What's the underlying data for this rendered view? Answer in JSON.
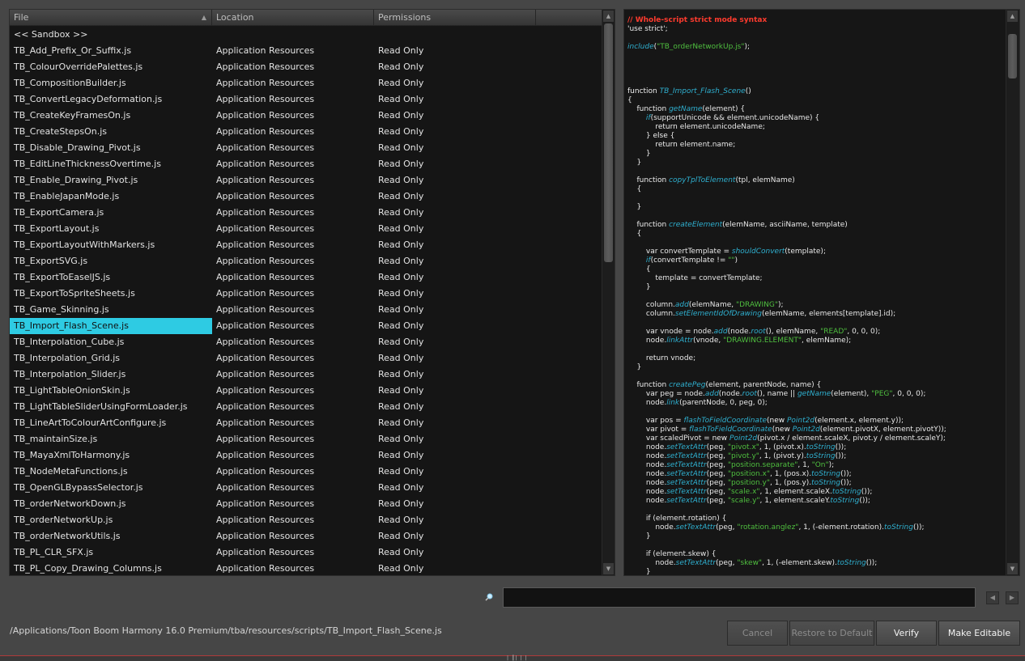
{
  "file_table": {
    "columns": {
      "file": "File",
      "location": "Location",
      "permissions": "Permissions"
    },
    "selected_index": 19,
    "rows": [
      {
        "file": "<< Sandbox >>",
        "location": "",
        "permissions": ""
      },
      {
        "file": "TB_Add_Prefix_Or_Suffix.js",
        "location": "Application Resources",
        "permissions": "Read Only"
      },
      {
        "file": "TB_ColourOverridePalettes.js",
        "location": "Application Resources",
        "permissions": "Read Only"
      },
      {
        "file": "TB_CompositionBuilder.js",
        "location": "Application Resources",
        "permissions": "Read Only"
      },
      {
        "file": "TB_ConvertLegacyDeformation.js",
        "location": "Application Resources",
        "permissions": "Read Only"
      },
      {
        "file": "TB_CreateKeyFramesOn.js",
        "location": "Application Resources",
        "permissions": "Read Only"
      },
      {
        "file": "TB_CreateStepsOn.js",
        "location": "Application Resources",
        "permissions": "Read Only"
      },
      {
        "file": "TB_Disable_Drawing_Pivot.js",
        "location": "Application Resources",
        "permissions": "Read Only"
      },
      {
        "file": "TB_EditLineThicknessOvertime.js",
        "location": "Application Resources",
        "permissions": "Read Only"
      },
      {
        "file": "TB_Enable_Drawing_Pivot.js",
        "location": "Application Resources",
        "permissions": "Read Only"
      },
      {
        "file": "TB_EnableJapanMode.js",
        "location": "Application Resources",
        "permissions": "Read Only"
      },
      {
        "file": "TB_ExportCamera.js",
        "location": "Application Resources",
        "permissions": "Read Only"
      },
      {
        "file": "TB_ExportLayout.js",
        "location": "Application Resources",
        "permissions": "Read Only"
      },
      {
        "file": "TB_ExportLayoutWithMarkers.js",
        "location": "Application Resources",
        "permissions": "Read Only"
      },
      {
        "file": "TB_ExportSVG.js",
        "location": "Application Resources",
        "permissions": "Read Only"
      },
      {
        "file": "TB_ExportToEaselJS.js",
        "location": "Application Resources",
        "permissions": "Read Only"
      },
      {
        "file": "TB_ExportToSpriteSheets.js",
        "location": "Application Resources",
        "permissions": "Read Only"
      },
      {
        "file": "TB_Game_Skinning.js",
        "location": "Application Resources",
        "permissions": "Read Only"
      },
      {
        "file": "TB_Import_Flash_Scene.js",
        "location": "Application Resources",
        "permissions": "Read Only"
      },
      {
        "file": "TB_Interpolation_Cube.js",
        "location": "Application Resources",
        "permissions": "Read Only"
      },
      {
        "file": "TB_Interpolation_Grid.js",
        "location": "Application Resources",
        "permissions": "Read Only"
      },
      {
        "file": "TB_Interpolation_Slider.js",
        "location": "Application Resources",
        "permissions": "Read Only"
      },
      {
        "file": "TB_LightTableOnionSkin.js",
        "location": "Application Resources",
        "permissions": "Read Only"
      },
      {
        "file": "TB_LightTableSliderUsingFormLoader.js",
        "location": "Application Resources",
        "permissions": "Read Only"
      },
      {
        "file": "TB_LineArtToColourArtConfigure.js",
        "location": "Application Resources",
        "permissions": "Read Only"
      },
      {
        "file": "TB_maintainSize.js",
        "location": "Application Resources",
        "permissions": "Read Only"
      },
      {
        "file": "TB_MayaXmlToHarmony.js",
        "location": "Application Resources",
        "permissions": "Read Only"
      },
      {
        "file": "TB_NodeMetaFunctions.js",
        "location": "Application Resources",
        "permissions": "Read Only"
      },
      {
        "file": "TB_OpenGLBypassSelector.js",
        "location": "Application Resources",
        "permissions": "Read Only"
      },
      {
        "file": "TB_orderNetworkDown.js",
        "location": "Application Resources",
        "permissions": "Read Only"
      },
      {
        "file": "TB_orderNetworkUp.js",
        "location": "Application Resources",
        "permissions": "Read Only"
      },
      {
        "file": "TB_orderNetworkUtils.js",
        "location": "Application Resources",
        "permissions": "Read Only"
      },
      {
        "file": "TB_PL_CLR_SFX.js",
        "location": "Application Resources",
        "permissions": "Read Only"
      },
      {
        "file": "TB_PL_Copy_Drawing_Columns.js",
        "location": "Application Resources",
        "permissions": "Read Only"
      }
    ]
  },
  "code_editor": {
    "lines": [
      [
        [
          "c",
          "// Whole-script strict mode syntax"
        ]
      ],
      [
        [
          "p",
          "'use strict';"
        ]
      ],
      [],
      [
        [
          "f",
          "include"
        ],
        [
          "p",
          "("
        ],
        [
          "s",
          "\"TB_orderNetworkUp.js\""
        ],
        [
          "p",
          ");"
        ]
      ],
      [],
      [],
      [],
      [],
      [
        [
          "k",
          "function "
        ],
        [
          "f",
          "TB_Import_Flash_Scene"
        ],
        [
          "p",
          "()"
        ]
      ],
      [
        [
          "p",
          "{"
        ]
      ],
      [
        [
          "k",
          "    function "
        ],
        [
          "f",
          "getName"
        ],
        [
          "p",
          "(element) {"
        ]
      ],
      [
        [
          "p",
          "        "
        ],
        [
          "f",
          "if"
        ],
        [
          "p",
          "(supportUnicode && element.unicodeName) {"
        ]
      ],
      [
        [
          "k",
          "            return "
        ],
        [
          "p",
          "element.unicodeName;"
        ]
      ],
      [
        [
          "p",
          "        } "
        ],
        [
          "k",
          "else"
        ],
        [
          "p",
          " {"
        ]
      ],
      [
        [
          "k",
          "            return "
        ],
        [
          "p",
          "element.name;"
        ]
      ],
      [
        [
          "p",
          "        }"
        ]
      ],
      [
        [
          "p",
          "    }"
        ]
      ],
      [],
      [
        [
          "k",
          "    function "
        ],
        [
          "f",
          "copyTplToElement"
        ],
        [
          "p",
          "(tpl, elemName)"
        ]
      ],
      [
        [
          "p",
          "    {"
        ]
      ],
      [],
      [
        [
          "p",
          "    }"
        ]
      ],
      [],
      [
        [
          "k",
          "    function "
        ],
        [
          "f",
          "createElement"
        ],
        [
          "p",
          "(elemName, asciiName, template)"
        ]
      ],
      [
        [
          "p",
          "    {"
        ]
      ],
      [],
      [
        [
          "k",
          "        var "
        ],
        [
          "p",
          "convertTemplate = "
        ],
        [
          "f",
          "shouldConvert"
        ],
        [
          "p",
          "(template);"
        ]
      ],
      [
        [
          "p",
          "        "
        ],
        [
          "f",
          "if"
        ],
        [
          "p",
          "(convertTemplate != "
        ],
        [
          "s",
          "\"\""
        ],
        [
          "p",
          ")"
        ]
      ],
      [
        [
          "p",
          "        {"
        ]
      ],
      [
        [
          "p",
          "            template = convertTemplate;"
        ]
      ],
      [
        [
          "p",
          "        }"
        ]
      ],
      [],
      [
        [
          "p",
          "        column."
        ],
        [
          "f",
          "add"
        ],
        [
          "p",
          "(elemName, "
        ],
        [
          "s",
          "\"DRAWING\""
        ],
        [
          "p",
          ");"
        ]
      ],
      [
        [
          "p",
          "        column."
        ],
        [
          "f",
          "setElementIdOfDrawing"
        ],
        [
          "p",
          "(elemName, elements[template].id);"
        ]
      ],
      [],
      [
        [
          "k",
          "        var "
        ],
        [
          "p",
          "vnode = node."
        ],
        [
          "f",
          "add"
        ],
        [
          "p",
          "(node."
        ],
        [
          "f",
          "root"
        ],
        [
          "p",
          "(), elemName, "
        ],
        [
          "s",
          "\"READ\""
        ],
        [
          "p",
          ", 0, 0, 0);"
        ]
      ],
      [
        [
          "p",
          "        node."
        ],
        [
          "f",
          "linkAttr"
        ],
        [
          "p",
          "(vnode, "
        ],
        [
          "s",
          "\"DRAWING.ELEMENT\""
        ],
        [
          "p",
          ", elemName);"
        ]
      ],
      [],
      [
        [
          "k",
          "        return "
        ],
        [
          "p",
          "vnode;"
        ]
      ],
      [
        [
          "p",
          "    }"
        ]
      ],
      [],
      [
        [
          "k",
          "    function "
        ],
        [
          "f",
          "createPeg"
        ],
        [
          "p",
          "(element, parentNode, name) {"
        ]
      ],
      [
        [
          "k",
          "        var "
        ],
        [
          "p",
          "peg = node."
        ],
        [
          "f",
          "add"
        ],
        [
          "p",
          "(node."
        ],
        [
          "f",
          "root"
        ],
        [
          "p",
          "(), name || "
        ],
        [
          "f",
          "getName"
        ],
        [
          "p",
          "(element), "
        ],
        [
          "s",
          "\"PEG\""
        ],
        [
          "p",
          ", 0, 0, 0);"
        ]
      ],
      [
        [
          "p",
          "        node."
        ],
        [
          "f",
          "link"
        ],
        [
          "p",
          "(parentNode, 0, peg, 0);"
        ]
      ],
      [],
      [
        [
          "k",
          "        var "
        ],
        [
          "p",
          "pos = "
        ],
        [
          "f",
          "flashToFieldCoordinate"
        ],
        [
          "p",
          "("
        ],
        [
          "k",
          "new "
        ],
        [
          "f",
          "Point2d"
        ],
        [
          "p",
          "(element.x, element.y));"
        ]
      ],
      [
        [
          "k",
          "        var "
        ],
        [
          "p",
          "pivot = "
        ],
        [
          "f",
          "flashToFieldCoordinate"
        ],
        [
          "p",
          "("
        ],
        [
          "k",
          "new "
        ],
        [
          "f",
          "Point2d"
        ],
        [
          "p",
          "(element.pivotX, element.pivotY));"
        ]
      ],
      [
        [
          "k",
          "        var "
        ],
        [
          "p",
          "scaledPivot = "
        ],
        [
          "k",
          "new "
        ],
        [
          "f",
          "Point2d"
        ],
        [
          "p",
          "(pivot.x / element.scaleX, pivot.y / element.scaleY);"
        ]
      ],
      [
        [
          "p",
          "        node."
        ],
        [
          "f",
          "setTextAttr"
        ],
        [
          "p",
          "(peg, "
        ],
        [
          "s",
          "\"pivot.x\""
        ],
        [
          "p",
          ", 1, (pivot.x)."
        ],
        [
          "f",
          "toString"
        ],
        [
          "p",
          "());"
        ]
      ],
      [
        [
          "p",
          "        node."
        ],
        [
          "f",
          "setTextAttr"
        ],
        [
          "p",
          "(peg, "
        ],
        [
          "s",
          "\"pivot.y\""
        ],
        [
          "p",
          ", 1, (pivot.y)."
        ],
        [
          "f",
          "toString"
        ],
        [
          "p",
          "());"
        ]
      ],
      [
        [
          "p",
          "        node."
        ],
        [
          "f",
          "setTextAttr"
        ],
        [
          "p",
          "(peg, "
        ],
        [
          "s",
          "\"position.separate\""
        ],
        [
          "p",
          ", 1, "
        ],
        [
          "s",
          "\"On\""
        ],
        [
          "p",
          ");"
        ]
      ],
      [
        [
          "p",
          "        node."
        ],
        [
          "f",
          "setTextAttr"
        ],
        [
          "p",
          "(peg, "
        ],
        [
          "s",
          "\"position.x\""
        ],
        [
          "p",
          ", 1, (pos.x)."
        ],
        [
          "f",
          "toString"
        ],
        [
          "p",
          "());"
        ]
      ],
      [
        [
          "p",
          "        node."
        ],
        [
          "f",
          "setTextAttr"
        ],
        [
          "p",
          "(peg, "
        ],
        [
          "s",
          "\"position.y\""
        ],
        [
          "p",
          ", 1, (pos.y)."
        ],
        [
          "f",
          "toString"
        ],
        [
          "p",
          "());"
        ]
      ],
      [
        [
          "p",
          "        node."
        ],
        [
          "f",
          "setTextAttr"
        ],
        [
          "p",
          "(peg, "
        ],
        [
          "s",
          "\"scale.x\""
        ],
        [
          "p",
          ", 1, element.scaleX."
        ],
        [
          "f",
          "toString"
        ],
        [
          "p",
          "());"
        ]
      ],
      [
        [
          "p",
          "        node."
        ],
        [
          "f",
          "setTextAttr"
        ],
        [
          "p",
          "(peg, "
        ],
        [
          "s",
          "\"scale.y\""
        ],
        [
          "p",
          ", 1, element.scaleY."
        ],
        [
          "f",
          "toString"
        ],
        [
          "p",
          "());"
        ]
      ],
      [],
      [
        [
          "p",
          "        if (element.rotation) {"
        ]
      ],
      [
        [
          "p",
          "            node."
        ],
        [
          "f",
          "setTextAttr"
        ],
        [
          "p",
          "(peg, "
        ],
        [
          "s",
          "\"rotation.anglez\""
        ],
        [
          "p",
          ", 1, (-element.rotation)."
        ],
        [
          "f",
          "toString"
        ],
        [
          "p",
          "());"
        ]
      ],
      [
        [
          "p",
          "        }"
        ]
      ],
      [],
      [
        [
          "p",
          "        if (element.skew) {"
        ]
      ],
      [
        [
          "p",
          "            node."
        ],
        [
          "f",
          "setTextAttr"
        ],
        [
          "p",
          "(peg, "
        ],
        [
          "s",
          "\"skew\""
        ],
        [
          "p",
          ", 1, (-element.skew)."
        ],
        [
          "f",
          "toString"
        ],
        [
          "p",
          "());"
        ]
      ],
      [
        [
          "p",
          "        }"
        ]
      ]
    ]
  },
  "search": {
    "value": "",
    "icon": "magnifier-icon"
  },
  "footer": {
    "path": "/Applications/Toon Boom Harmony 16.0 Premium/tba/resources/scripts/TB_Import_Flash_Scene.js",
    "buttons": {
      "cancel": "Cancel",
      "restore": "Restore to Default",
      "verify": "Verify",
      "make_editable": "Make Editable"
    }
  },
  "colors": {
    "selection": "#2ecbe3",
    "comment": "#ff3b2e",
    "function": "#2fb0d0",
    "string": "#4fbf3f"
  }
}
